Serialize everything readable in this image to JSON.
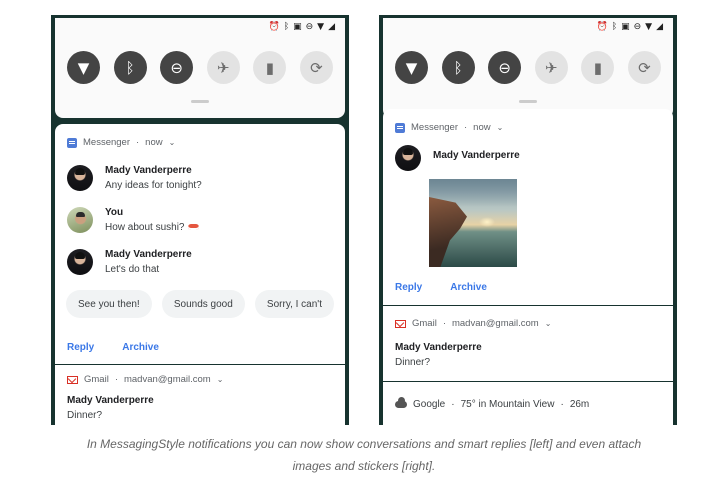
{
  "left": {
    "messenger": {
      "app_name": "Messenger",
      "time": "now",
      "messages": [
        {
          "sender": "Mady Vanderperre",
          "text": "Any ideas for tonight?"
        },
        {
          "sender": "You",
          "text": "How about sushi?"
        },
        {
          "sender": "Mady Vanderperre",
          "text": "Let's do that"
        }
      ],
      "smart_replies": [
        "See you then!",
        "Sounds good",
        "Sorry, I can't"
      ],
      "actions": {
        "reply": "Reply",
        "archive": "Archive"
      }
    },
    "gmail": {
      "app_name": "Gmail",
      "account": "madvan@gmail.com",
      "sender": "Mady Vanderperre",
      "text": "Dinner?"
    }
  },
  "right": {
    "messenger": {
      "app_name": "Messenger",
      "time": "now",
      "sender": "Mady Vanderperre",
      "actions": {
        "reply": "Reply",
        "archive": "Archive"
      }
    },
    "gmail": {
      "app_name": "Gmail",
      "account": "madvan@gmail.com",
      "sender": "Mady Vanderperre",
      "text": "Dinner?"
    },
    "google": {
      "app_name": "Google",
      "weather": "75° in Mountain View",
      "time": "26m"
    }
  },
  "quick_settings": [
    "wifi-icon",
    "bluetooth-icon",
    "do-not-disturb-icon",
    "airplane-mode-icon",
    "flashlight-icon",
    "auto-rotate-icon"
  ],
  "status_bar": [
    "alarm-icon",
    "bluetooth-icon",
    "cast-icon",
    "do-not-disturb-icon",
    "wifi-icon",
    "signal-icon"
  ],
  "caption": {
    "line1": "In MessagingStyle notifications you can now show conversations and smart replies [left] and even attach",
    "line2": "images and stickers [right]."
  },
  "colors": {
    "accent": "#3b78e7",
    "phone_bg": "#17332f",
    "gmail_red": "#d93025"
  }
}
